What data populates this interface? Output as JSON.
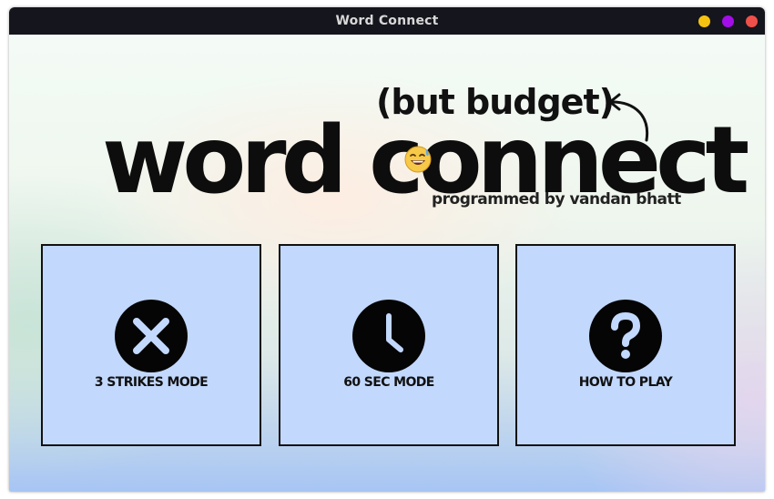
{
  "window": {
    "title": "Word Connect",
    "controls": {
      "minimize_color": "#f5c211",
      "maximize_color": "#a30ee8",
      "close_color": "#f0504a"
    }
  },
  "hero": {
    "subtitle": "(but budget)",
    "title_before": "word co",
    "title_after": "nnect",
    "credit": "programmed by vandan bhatt",
    "emoji_icon": "sweat-smile-emoji"
  },
  "modes": [
    {
      "label": "3 STRIKES MODE",
      "icon": "x-icon"
    },
    {
      "label": "60 SEC MODE",
      "icon": "clock-icon"
    },
    {
      "label": "HOW TO PLAY",
      "icon": "question-icon"
    }
  ],
  "colors": {
    "card_bg": "#c2d8fc",
    "titlebar_bg": "#15151d",
    "text_dark": "#0d0d0d"
  }
}
